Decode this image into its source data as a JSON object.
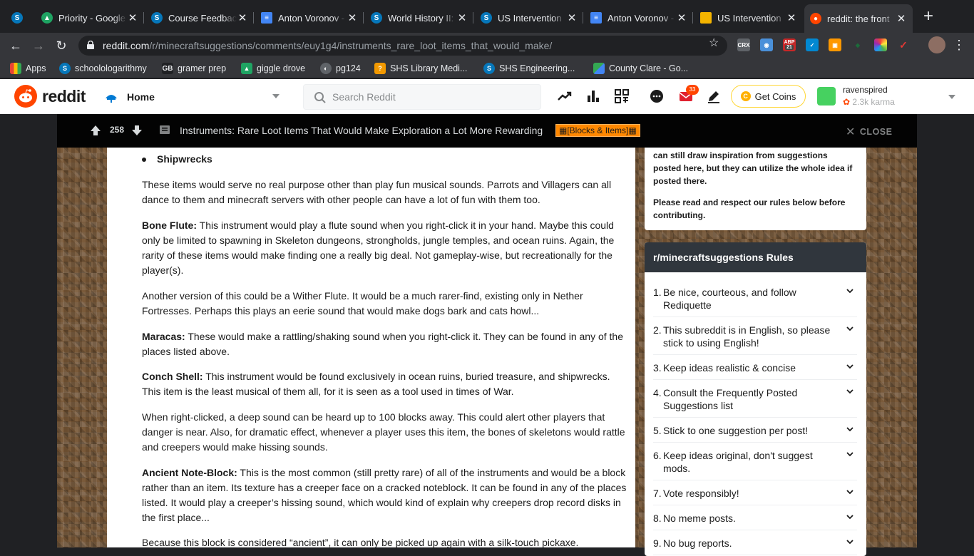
{
  "browser": {
    "tabs": [
      {
        "title": "Priority - Google",
        "icon": "drive-icon",
        "color": "#1a73e8"
      },
      {
        "title": "Course Feedback",
        "icon": "schoology-icon",
        "color": "#0677ba"
      },
      {
        "title": "Anton Voronov -",
        "icon": "docs-icon",
        "color": "#4285f4"
      },
      {
        "title": "World History II:",
        "icon": "schoology-icon",
        "color": "#0677ba"
      },
      {
        "title": "US Intervention",
        "icon": "schoology-icon",
        "color": "#0677ba"
      },
      {
        "title": "Anton Voronov -",
        "icon": "docs-icon",
        "color": "#4285f4"
      },
      {
        "title": "US Intervention",
        "icon": "slides-icon",
        "color": "#f4b400"
      },
      {
        "title": "reddit: the front",
        "icon": "reddit-icon",
        "color": "#ff4500"
      }
    ],
    "url_host": "reddit.com",
    "url_path": "/r/minecraftsuggestions/comments/euy1g4/instruments_rare_loot_items_that_would_make/",
    "ext_badge": "21",
    "bookmarks": [
      "Apps",
      "schoolologarithmy",
      "gramer prep",
      "giggle drove",
      "pg124",
      "SHS Library Medi...",
      "SHS Engineering...",
      "County Clare - Go..."
    ]
  },
  "reddit": {
    "wordmark": "reddit",
    "home": "Home",
    "search_placeholder": "Search Reddit",
    "notif_count": "33",
    "get_coins": "Get Coins",
    "username": "ravenspired",
    "karma": "2.3k karma"
  },
  "post": {
    "score": "258",
    "title": "Instruments: Rare Loot Items That Would Make Exploration a Lot More Rewarding",
    "flair": "[Blocks & Items]",
    "close": "CLOSE",
    "bullet": "Shipwrecks",
    "paragraphs": [
      {
        "bold": "",
        "text": "These items would serve no real purpose other than play fun musical sounds. Parrots and Villagers can all dance to them and minecraft servers with other people can have a lot of fun with them too."
      },
      {
        "bold": "Bone Flute:",
        "text": " This instrument would play a flute sound when you right-click it in your hand. Maybe this could only be limited to spawning in Skeleton dungeons, strongholds, jungle temples, and ocean ruins. Again, the rarity of these items would make finding one a really big deal. Not gameplay-wise, but recreationally for the player(s)."
      },
      {
        "bold": "",
        "text": "Another version of this could be a Wither Flute. It would be a much rarer-find, existing only in Nether Fortresses. Perhaps this plays an eerie sound that would make dogs bark and cats howl..."
      },
      {
        "bold": "Maracas:",
        "text": " These would make a rattling/shaking sound when you right-click it. They can be found in any of the places listed above."
      },
      {
        "bold": "Conch Shell:",
        "text": " This instrument would be found exclusively in ocean ruins, buried treasure, and shipwrecks. This item is the least musical of them all, for it is seen as a tool used in times of War."
      },
      {
        "bold": "",
        "text": "When right-clicked, a deep sound can be heard up to 100 blocks away. This could alert other players that danger is near. Also, for dramatic effect, whenever a player uses this item, the bones of skeletons would rattle and creepers would make hissing sounds."
      },
      {
        "bold": "Ancient Note-Block:",
        "text": " This is the most common (still pretty rare) of all of the instruments and would be a block rather than an item. Its texture has a creeper face on a cracked noteblock. It can be found in any of the places listed. It would play a creeper’s hissing sound, which would kind of explain why creepers drop record disks in the first place..."
      },
      {
        "bold": "",
        "text": "Because this block is considered “ancient”, it can only be picked up again with a silk-touch pickaxe."
      }
    ]
  },
  "sidebar": {
    "about_line1": "can still draw inspiration from suggestions posted here, but they can utilize the whole idea if posted there.",
    "about_line2": "Please read and respect our rules below before contributing.",
    "rules_title": "r/minecraftsuggestions Rules",
    "rules": [
      {
        "n": "1.",
        "text": "Be nice, courteous, and follow Rediquette"
      },
      {
        "n": "2.",
        "text": "This subreddit is in English, so please stick to using English!"
      },
      {
        "n": "3.",
        "text": "Keep ideas realistic & concise"
      },
      {
        "n": "4.",
        "text": "Consult the Frequently Posted Suggestions list"
      },
      {
        "n": "5.",
        "text": "Stick to one suggestion per post!"
      },
      {
        "n": "6.",
        "text": "Keep ideas original, don't suggest mods."
      },
      {
        "n": "7.",
        "text": "Vote responsibly!"
      },
      {
        "n": "8.",
        "text": "No meme posts."
      },
      {
        "n": "9.",
        "text": "No bug reports."
      }
    ]
  }
}
